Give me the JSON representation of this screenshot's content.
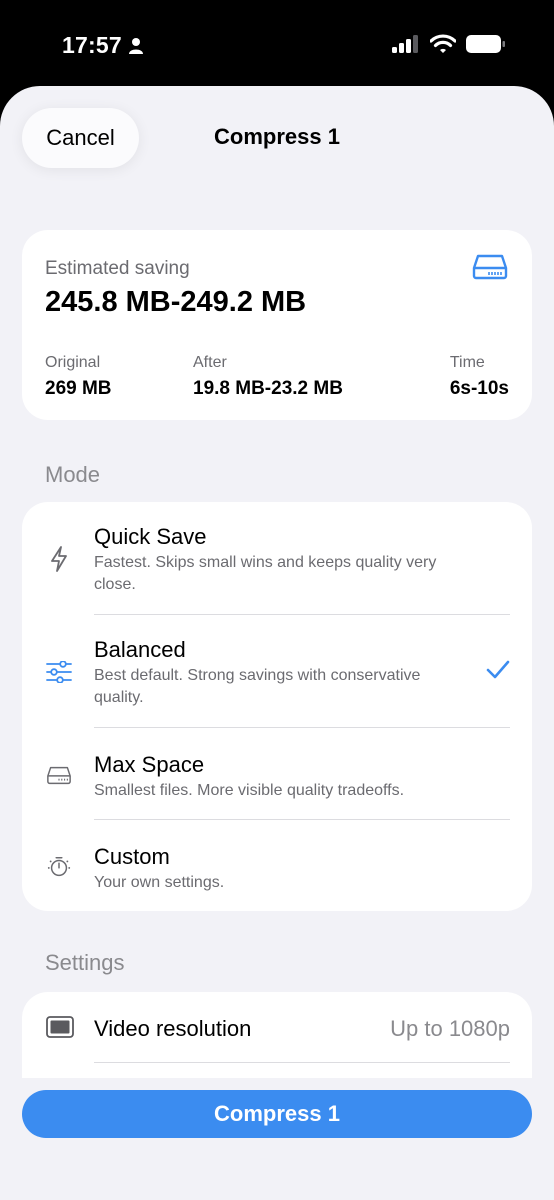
{
  "status_bar": {
    "time": "17:57"
  },
  "header": {
    "cancel_label": "Cancel",
    "title": "Compress 1"
  },
  "summary": {
    "estimated_label": "Estimated saving",
    "estimated_value": "245.8 MB-249.2 MB",
    "original_label": "Original",
    "original_value": "269 MB",
    "after_label": "After",
    "after_value": "19.8 MB-23.2 MB",
    "time_label": "Time",
    "time_value": "6s-10s"
  },
  "mode": {
    "header": "Mode",
    "options": [
      {
        "title": "Quick Save",
        "desc": "Fastest. Skips small wins and keeps quality very close.",
        "icon": "bolt-icon",
        "selected": false
      },
      {
        "title": "Balanced",
        "desc": "Best default. Strong savings with conservative quality.",
        "icon": "sliders-icon",
        "selected": true
      },
      {
        "title": "Max Space",
        "desc": "Smallest files. More visible quality tradeoffs.",
        "icon": "drive-icon",
        "selected": false
      },
      {
        "title": "Custom",
        "desc": "Your own settings.",
        "icon": "timer-icon",
        "selected": false
      }
    ]
  },
  "settings": {
    "header": "Settings",
    "video_resolution_label": "Video resolution",
    "video_resolution_value": "Up to 1080p"
  },
  "footer": {
    "compress_label": "Compress 1"
  },
  "colors": {
    "accent": "#3b8cf0",
    "background": "#f2f2f7",
    "secondary_text": "#6b6b70"
  }
}
